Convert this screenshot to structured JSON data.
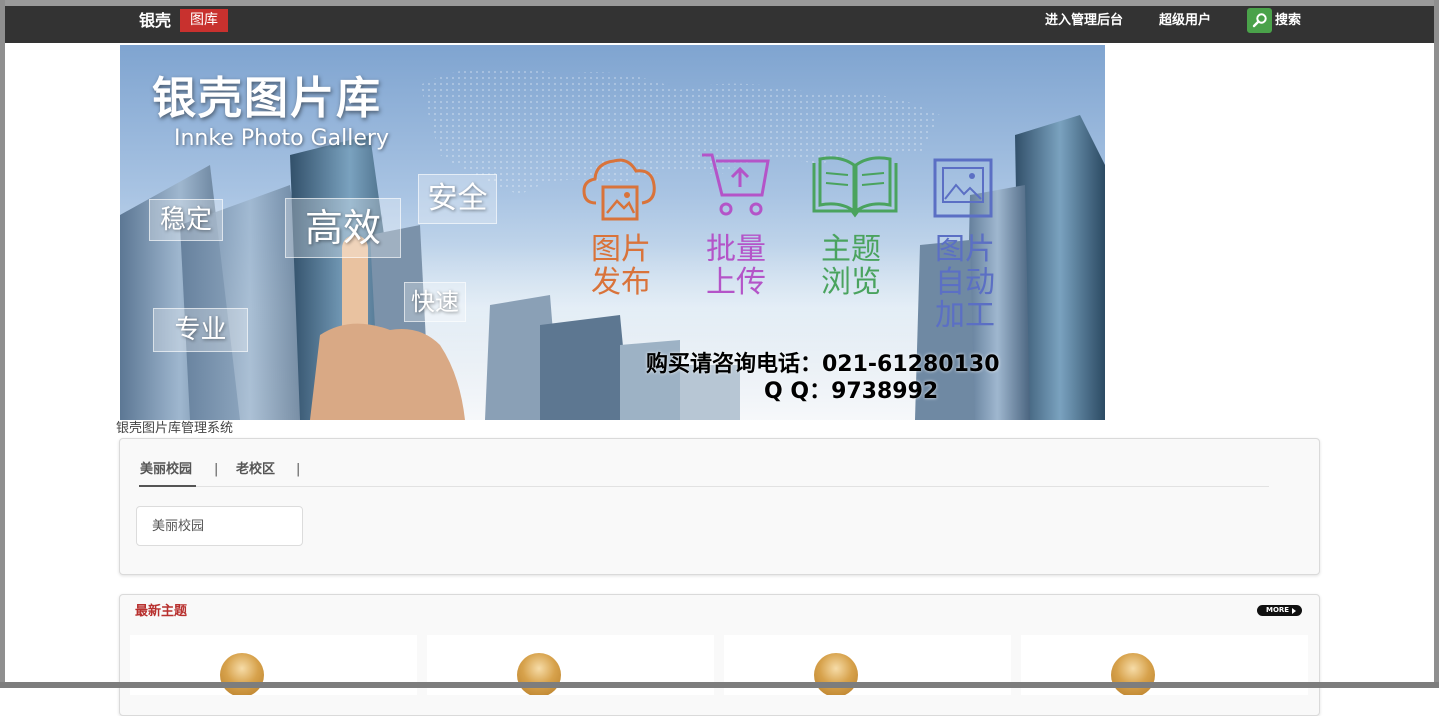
{
  "navbar": {
    "logo_text": "银壳",
    "logo_badge": "图库",
    "admin_link": "进入管理后台",
    "user_link": "超级用户",
    "search_label": "搜索"
  },
  "banner": {
    "title": "银壳图片库",
    "subtitle": "Innke  Photo Gallery",
    "tags": [
      "稳定",
      "高效",
      "安全",
      "快速",
      "专业"
    ],
    "features": [
      {
        "lines": [
          "图片",
          "发布"
        ],
        "color": "#d9733a",
        "icon": "cloud-image-icon"
      },
      {
        "lines": [
          "批量",
          "上传"
        ],
        "color": "#b454c8",
        "icon": "cart-upload-icon"
      },
      {
        "lines": [
          "主题",
          "浏览"
        ],
        "color": "#4aa35e",
        "icon": "open-book-icon"
      },
      {
        "lines": [
          "图片",
          "自动",
          "加工"
        ],
        "color": "#5b6fc4",
        "icon": "picture-frame-icon"
      }
    ],
    "contact_phone": "购买请咨询电话：021-61280130",
    "contact_qq": "Q Q：9738992"
  },
  "system_name": "银壳图片库管理系统",
  "albums_panel": {
    "tabs": [
      "美丽校园",
      "老校区"
    ],
    "active_tab": "美丽校园",
    "album_card": "美丽校园"
  },
  "latest_panel": {
    "title": "最新主题",
    "more_label": "MORE",
    "thumb_icons": [
      "bulb-image",
      "bulb-image",
      "bulb-image",
      "bulb-image"
    ]
  }
}
